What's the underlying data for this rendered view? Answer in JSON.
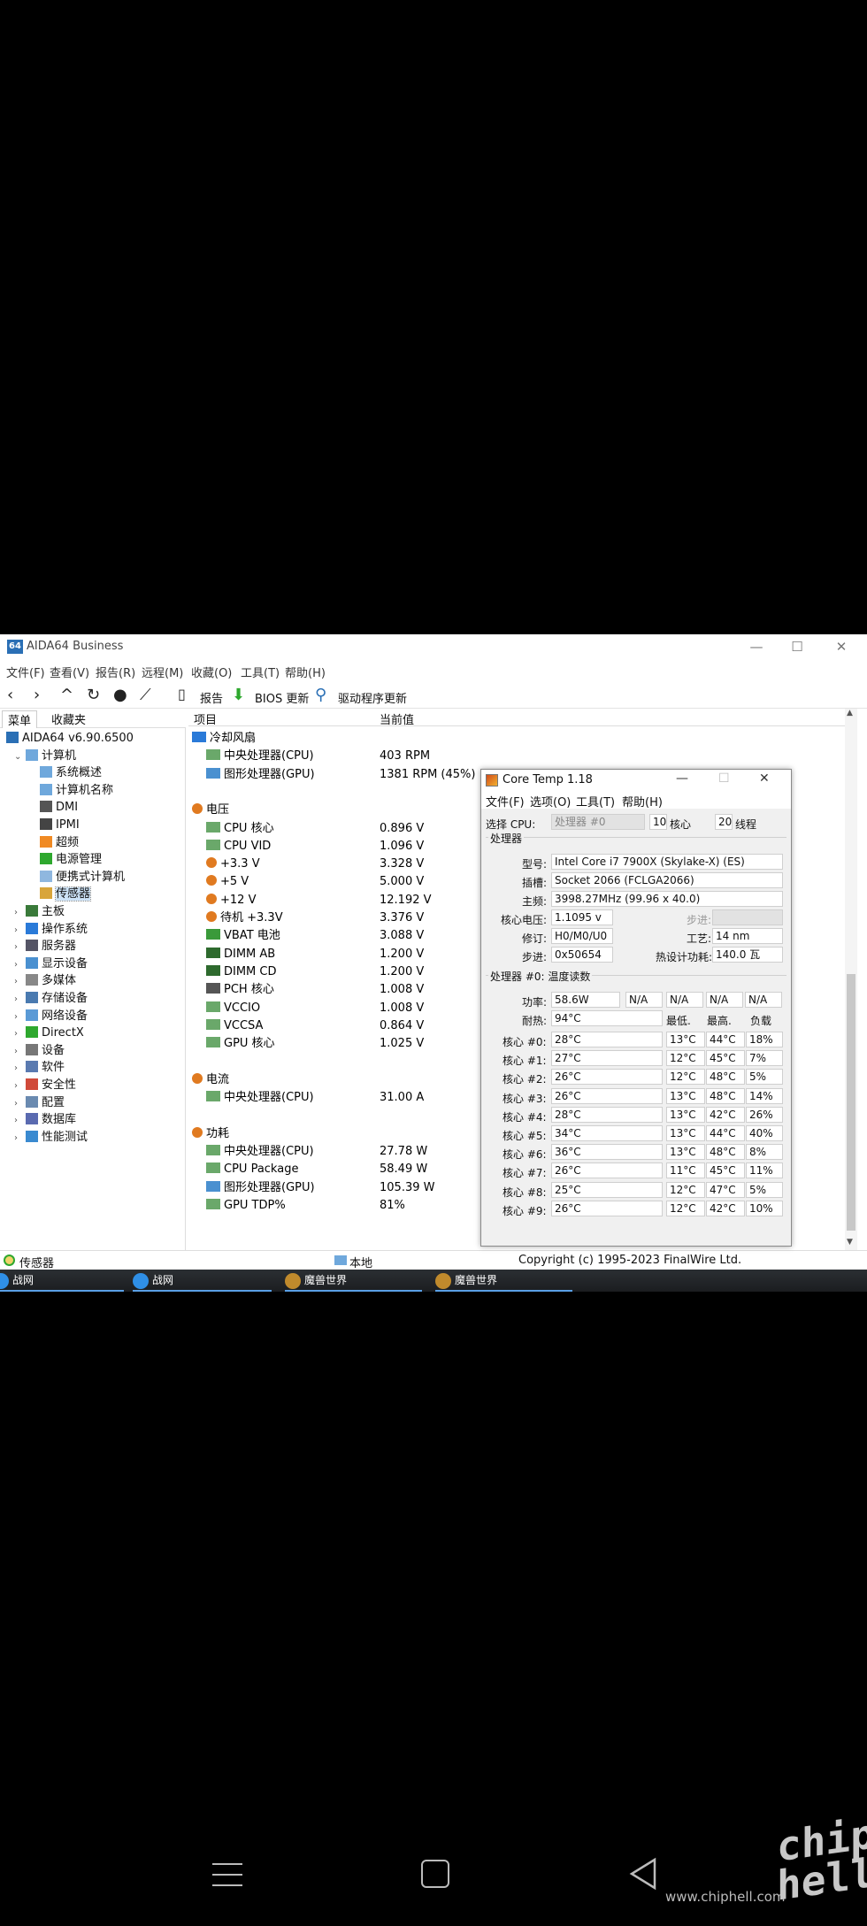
{
  "window": {
    "logo": "64",
    "title": "AIDA64 Business",
    "controls": [
      "—",
      "☐",
      "✕"
    ]
  },
  "menu": [
    "文件(F)",
    "查看(V)",
    "报告(R)",
    "远程(M)",
    "收藏(O)",
    "工具(T)",
    "帮助(H)"
  ],
  "toolbar": {
    "report_label": "报告",
    "bios_label": "BIOS 更新",
    "driver_label": "驱动程序更新"
  },
  "left_tabs": [
    "菜单",
    "收藏夹"
  ],
  "tree": [
    {
      "label": "AIDA64 v6.90.6500",
      "icon": "app-64-icon",
      "indent": 0,
      "expander": ""
    },
    {
      "label": "计算机",
      "icon": "computer-icon",
      "indent": 1,
      "expander": "⌄"
    },
    {
      "label": "系统概述",
      "icon": "computer-icon",
      "indent": 2,
      "expander": ""
    },
    {
      "label": "计算机名称",
      "icon": "computer-icon",
      "indent": 2,
      "expander": ""
    },
    {
      "label": "DMI",
      "icon": "dmi-icon",
      "indent": 2,
      "expander": ""
    },
    {
      "label": "IPMI",
      "icon": "ipmi-icon",
      "indent": 2,
      "expander": ""
    },
    {
      "label": "超频",
      "icon": "flame-icon",
      "indent": 2,
      "expander": ""
    },
    {
      "label": "电源管理",
      "icon": "power-icon",
      "indent": 2,
      "expander": ""
    },
    {
      "label": "便携式计算机",
      "icon": "laptop-icon",
      "indent": 2,
      "expander": ""
    },
    {
      "label": "传感器",
      "icon": "sensor-icon",
      "indent": 2,
      "expander": "",
      "selected": true
    },
    {
      "label": "主板",
      "icon": "motherboard-icon",
      "indent": 1,
      "expander": "›"
    },
    {
      "label": "操作系统",
      "icon": "windows-icon",
      "indent": 1,
      "expander": "›"
    },
    {
      "label": "服务器",
      "icon": "server-icon",
      "indent": 1,
      "expander": "›"
    },
    {
      "label": "显示设备",
      "icon": "display-icon",
      "indent": 1,
      "expander": "›"
    },
    {
      "label": "多媒体",
      "icon": "multimedia-icon",
      "indent": 1,
      "expander": "›"
    },
    {
      "label": "存储设备",
      "icon": "storage-icon",
      "indent": 1,
      "expander": "›"
    },
    {
      "label": "网络设备",
      "icon": "network-icon",
      "indent": 1,
      "expander": "›"
    },
    {
      "label": "DirectX",
      "icon": "xbox-icon",
      "indent": 1,
      "expander": "›"
    },
    {
      "label": "设备",
      "icon": "device-icon",
      "indent": 1,
      "expander": "›"
    },
    {
      "label": "软件",
      "icon": "software-icon",
      "indent": 1,
      "expander": "›"
    },
    {
      "label": "安全性",
      "icon": "shield-icon",
      "indent": 1,
      "expander": "›"
    },
    {
      "label": "配置",
      "icon": "config-icon",
      "indent": 1,
      "expander": "›"
    },
    {
      "label": "数据库",
      "icon": "database-icon",
      "indent": 1,
      "expander": "›"
    },
    {
      "label": "性能测试",
      "icon": "benchmark-icon",
      "indent": 1,
      "expander": "›"
    }
  ],
  "columns": {
    "item": "项目",
    "value": "当前值"
  },
  "rows": [
    {
      "kind": "group",
      "label": "冷却风扇",
      "icon": "fan-icon"
    },
    {
      "kind": "item",
      "label": "中央处理器(CPU)",
      "value": "403 RPM",
      "icon": "cpu-fan-icon"
    },
    {
      "kind": "item",
      "label": "图形处理器(GPU)",
      "value": "1381 RPM  (45%)",
      "icon": "gpu-icon"
    },
    {
      "kind": "gap"
    },
    {
      "kind": "group",
      "label": "电压",
      "icon": "voltage-icon"
    },
    {
      "kind": "item",
      "label": "CPU 核心",
      "value": "0.896 V",
      "icon": "cpu-icon"
    },
    {
      "kind": "item",
      "label": "CPU VID",
      "value": "1.096 V",
      "icon": "cpu-icon"
    },
    {
      "kind": "item",
      "label": "+3.3 V",
      "value": "3.328 V",
      "icon": "voltage-icon"
    },
    {
      "kind": "item",
      "label": "+5 V",
      "value": "5.000 V",
      "icon": "voltage-icon"
    },
    {
      "kind": "item",
      "label": "+12 V",
      "value": "12.192 V",
      "icon": "voltage-icon"
    },
    {
      "kind": "item",
      "label": "待机 +3.3V",
      "value": "3.376 V",
      "icon": "voltage-icon"
    },
    {
      "kind": "item",
      "label": "VBAT 电池",
      "value": "3.088 V",
      "icon": "battery-icon"
    },
    {
      "kind": "item",
      "label": "DIMM AB",
      "value": "1.200 V",
      "icon": "dimm-icon"
    },
    {
      "kind": "item",
      "label": "DIMM CD",
      "value": "1.200 V",
      "icon": "dimm-icon"
    },
    {
      "kind": "item",
      "label": "PCH 核心",
      "value": "1.008 V",
      "icon": "chip-icon"
    },
    {
      "kind": "item",
      "label": "VCCIO",
      "value": "1.008 V",
      "icon": "cpu-icon"
    },
    {
      "kind": "item",
      "label": "VCCSA",
      "value": "0.864 V",
      "icon": "cpu-icon"
    },
    {
      "kind": "item",
      "label": "GPU 核心",
      "value": "1.025 V",
      "icon": "cpu-icon"
    },
    {
      "kind": "gap"
    },
    {
      "kind": "group",
      "label": "电流",
      "icon": "voltage-icon"
    },
    {
      "kind": "item",
      "label": "中央处理器(CPU)",
      "value": "31.00 A",
      "icon": "cpu-icon"
    },
    {
      "kind": "gap"
    },
    {
      "kind": "group",
      "label": "功耗",
      "icon": "voltage-icon"
    },
    {
      "kind": "item",
      "label": "中央处理器(CPU)",
      "value": "27.78 W",
      "icon": "cpu-icon"
    },
    {
      "kind": "item",
      "label": "CPU Package",
      "value": "58.49 W",
      "icon": "cpu-icon"
    },
    {
      "kind": "item",
      "label": "图形处理器(GPU)",
      "value": "105.39 W",
      "icon": "gpu-icon"
    },
    {
      "kind": "item",
      "label": "GPU TDP%",
      "value": "81%",
      "icon": "gpu-tdp-icon"
    }
  ],
  "status": {
    "left": "传感器",
    "mid": "本地",
    "right": "Copyright (c) 1995-2023 FinalWire Ltd."
  },
  "taskbar": [
    {
      "label": "战网",
      "color": "#2f8fe6"
    },
    {
      "label": "战网",
      "color": "#2f8fe6"
    },
    {
      "label": "魔兽世界",
      "color": "#c08a2c"
    },
    {
      "label": "魔兽世界",
      "color": "#c08a2c"
    }
  ],
  "coretemp": {
    "title": "Core Temp 1.18",
    "controls": [
      "—",
      "☐",
      "✕"
    ],
    "menu": [
      "文件(F)",
      "选项(O)",
      "工具(T)",
      "帮助(H)"
    ],
    "select_cpu_label": "选择 CPU:",
    "select_cpu_value": "处理器 #0",
    "cores_value": "10",
    "cores_label": "核心",
    "threads_value": "20",
    "threads_label": "线程",
    "processor_section": "处理器",
    "model_label": "型号:",
    "model_value": "Intel Core i7 7900X (Skylake-X)  (ES)",
    "socket_label": "插槽:",
    "socket_value": "Socket 2066 (FCLGA2066)",
    "freq_label": "主频:",
    "freq_value": "3998.27MHz (99.96 x 40.0)",
    "vcore_label": "核心电压:",
    "vcore_value": "1.1095 v",
    "stepping_label": "步进:",
    "stepping_value": "",
    "revision_label": "修订:",
    "revision_value": "H0/M0/U0",
    "process_label": "工艺:",
    "process_value": "14 nm",
    "step_label": "步进:",
    "step_value": "0x50654",
    "tdp_label": "热设计功耗:",
    "tdp_value": "140.0 瓦",
    "temp_section": "处理器 #0: 温度读数",
    "power_label": "功率:",
    "power_value": "58.6W",
    "power_na": [
      "N/A",
      "N/A",
      "N/A",
      "N/A"
    ],
    "tjmax_label": "耐热:",
    "tjmax_value": "94°C",
    "col_min": "最低.",
    "col_max": "最高.",
    "col_load": "负载",
    "cores": [
      {
        "label": "核心 #0:",
        "temp": "28°C",
        "min": "13°C",
        "max": "44°C",
        "load": "18%"
      },
      {
        "label": "核心 #1:",
        "temp": "27°C",
        "min": "12°C",
        "max": "45°C",
        "load": "7%"
      },
      {
        "label": "核心 #2:",
        "temp": "26°C",
        "min": "12°C",
        "max": "48°C",
        "load": "5%"
      },
      {
        "label": "核心 #3:",
        "temp": "26°C",
        "min": "13°C",
        "max": "48°C",
        "load": "14%"
      },
      {
        "label": "核心 #4:",
        "temp": "28°C",
        "min": "13°C",
        "max": "42°C",
        "load": "26%"
      },
      {
        "label": "核心 #5:",
        "temp": "34°C",
        "min": "13°C",
        "max": "44°C",
        "load": "40%"
      },
      {
        "label": "核心 #6:",
        "temp": "36°C",
        "min": "13°C",
        "max": "48°C",
        "load": "8%"
      },
      {
        "label": "核心 #7:",
        "temp": "26°C",
        "min": "11°C",
        "max": "45°C",
        "load": "11%"
      },
      {
        "label": "核心 #8:",
        "temp": "25°C",
        "min": "12°C",
        "max": "47°C",
        "load": "5%"
      },
      {
        "label": "核心 #9:",
        "temp": "26°C",
        "min": "12°C",
        "max": "42°C",
        "load": "10%"
      }
    ]
  },
  "nav": {
    "menu": "≡",
    "home": "▢",
    "back": "◁"
  },
  "watermark": {
    "url": "www.chiphell.com",
    "logo": "chip\nhell"
  }
}
